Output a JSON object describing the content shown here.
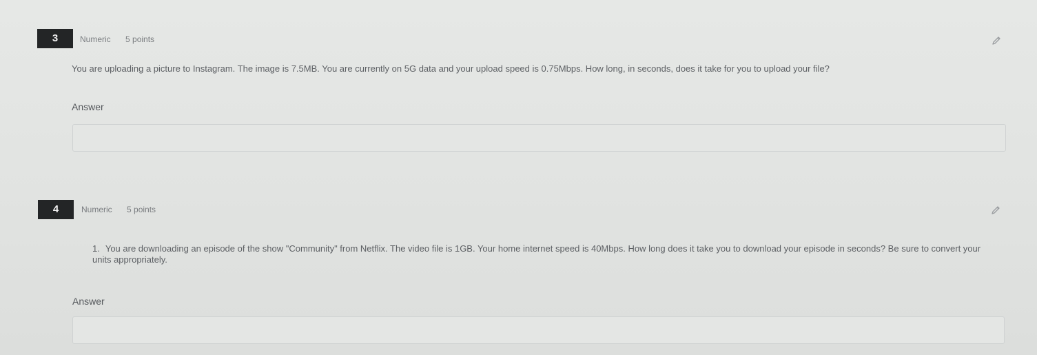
{
  "questions": [
    {
      "number": "3",
      "type": "Numeric",
      "points": "5 points",
      "list_number": "",
      "text": "You are uploading a picture to Instagram. The image is 7.5MB. You are currently on 5G data and your upload speed is 0.75Mbps. How long, in seconds, does it take for you to upload your file?",
      "answer_label": "Answer",
      "answer_value": ""
    },
    {
      "number": "4",
      "type": "Numeric",
      "points": "5 points",
      "list_number": "1.",
      "text": "You are downloading an episode of the show \"Community\" from Netflix. The video file is 1GB. Your home internet speed is 40Mbps. How long does it take you to download your episode in seconds? Be sure to convert your units appropriately.",
      "answer_label": "Answer",
      "answer_value": ""
    }
  ],
  "icons": {
    "edit": "pencil-icon"
  },
  "colors": {
    "question_number_bg": "#232526",
    "page_bg": "#e2e4e2"
  }
}
